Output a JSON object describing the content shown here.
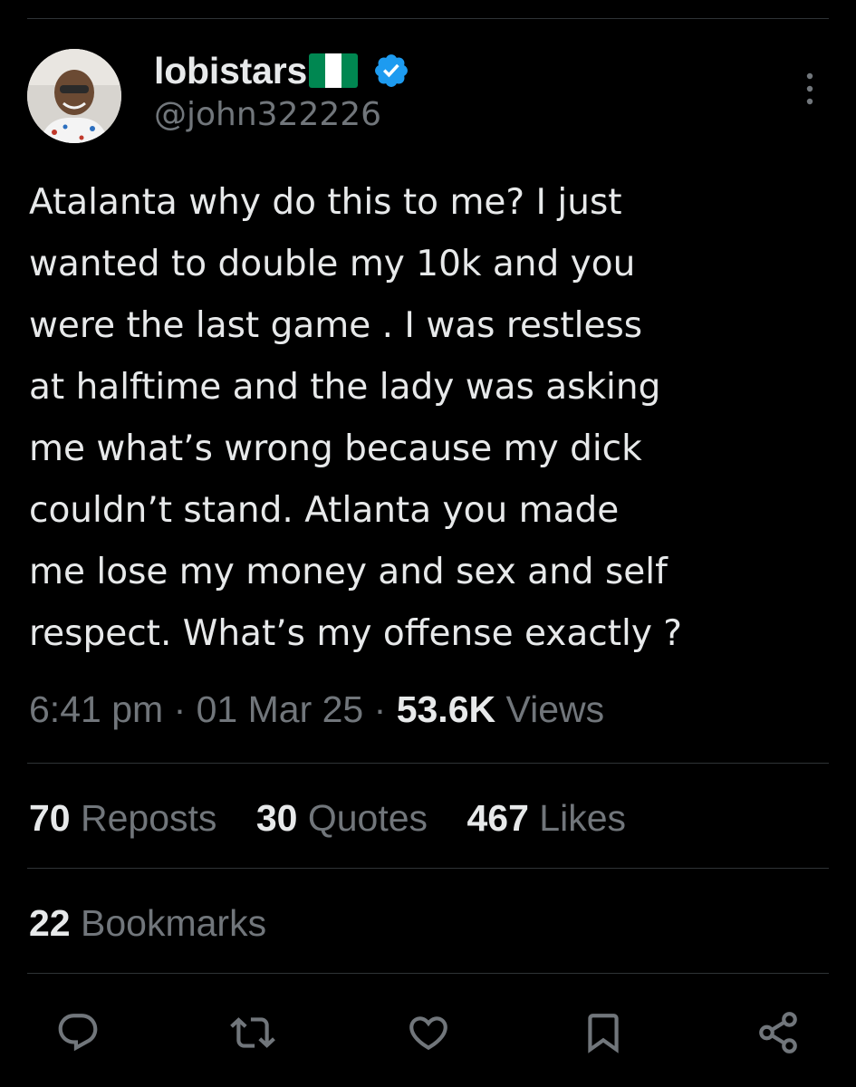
{
  "user": {
    "display_name": "lobistars",
    "handle": "@john322226",
    "flag_icon": "nigeria-flag-icon",
    "verified_icon": "verified-badge-icon",
    "avatar_icon": "avatar"
  },
  "tweet": {
    "text": "Atalanta why do this to me? I just\nwanted to double my 10k and you\nwere the last game . I was restless\nat halftime and the lady was asking\nme what’s wrong because my dick\ncouldn’t stand. Atlanta you made\nme lose my money and sex and self\nrespect. What’s my offense exactly ?",
    "time": "6:41 pm",
    "separator": "·",
    "date": "01 Mar 25",
    "views_count": "53.6K",
    "views_label": "Views"
  },
  "stats": {
    "reposts_count": "70",
    "reposts_label": "Reposts",
    "quotes_count": "30",
    "quotes_label": "Quotes",
    "likes_count": "467",
    "likes_label": "Likes",
    "bookmarks_count": "22",
    "bookmarks_label": "Bookmarks"
  },
  "actions": [
    "reply-icon",
    "repost-icon",
    "like-icon",
    "bookmark-icon",
    "share-icon"
  ],
  "colors": {
    "background": "#000000",
    "primary_text": "#e7e9ea",
    "secondary_text": "#71767b",
    "divider": "#2f3336",
    "verified_blue": "#1d9bf0",
    "flag_green": "#008751",
    "flag_white": "#ffffff"
  }
}
